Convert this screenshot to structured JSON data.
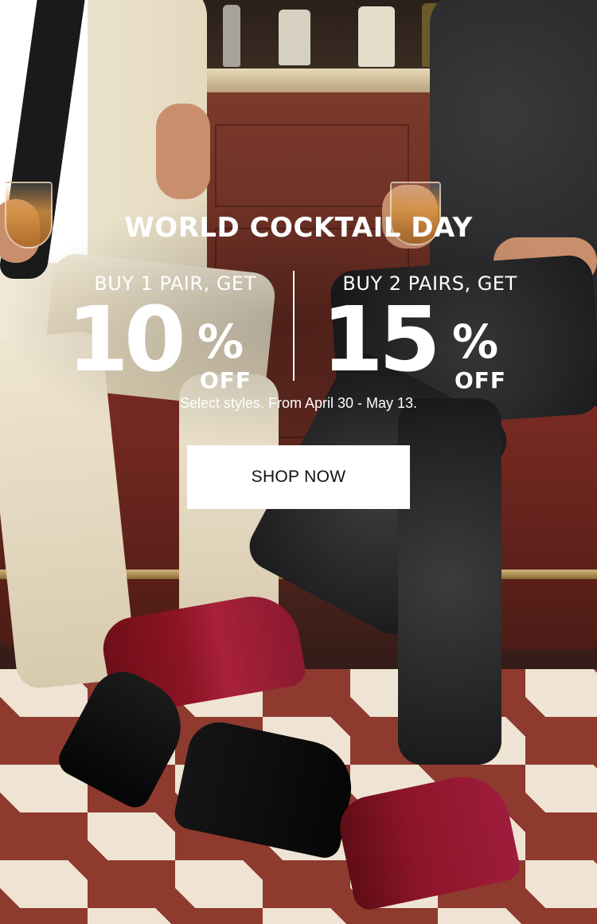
{
  "promo": {
    "headline": "WORLD COCKTAIL DAY",
    "offers": [
      {
        "lead": "BUY 1 PAIR, GET",
        "number": "10",
        "percent": "%",
        "off": "OFF"
      },
      {
        "lead": "BUY 2 PAIRS, GET",
        "number": "15",
        "percent": "%",
        "off": "OFF"
      }
    ],
    "fine_print": "Select styles. From April 30 - May 13.",
    "cta_label": "SHOP NOW"
  },
  "colors": {
    "text": "#ffffff",
    "button_bg": "#ffffff",
    "button_text": "#111111"
  },
  "image": {
    "scene": "bar-background-photo",
    "product": "dress-shoes"
  }
}
